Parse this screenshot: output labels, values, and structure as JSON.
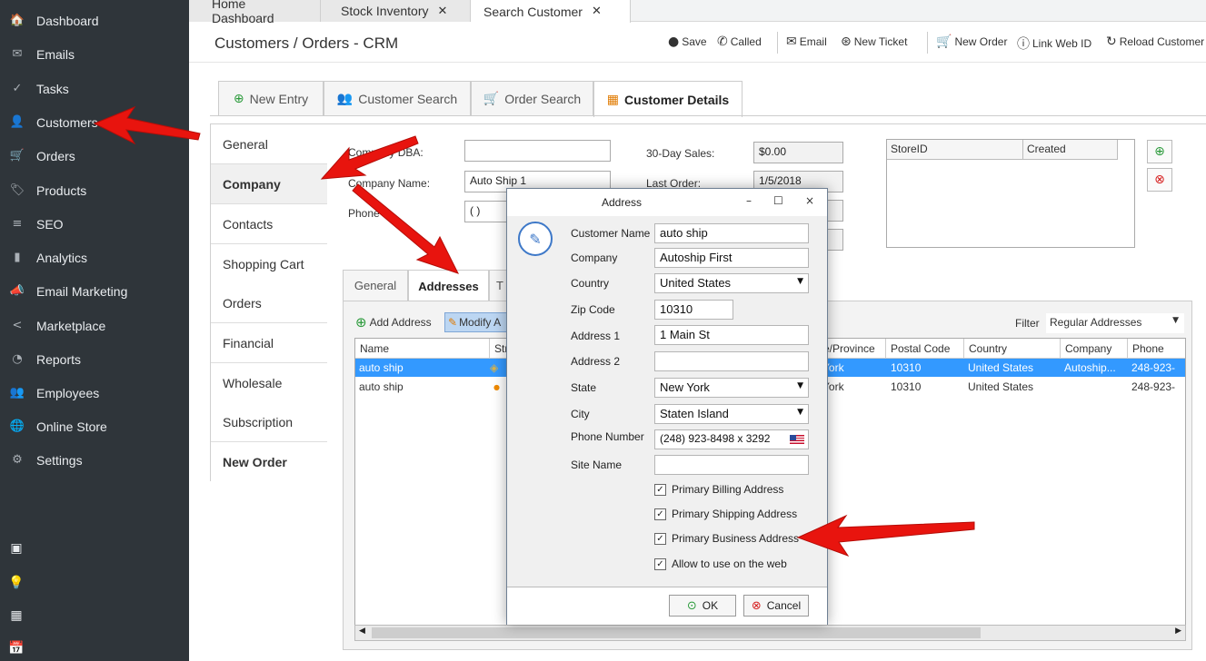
{
  "sidebar": {
    "items": [
      {
        "label": "Dashboard",
        "icon": "🏠"
      },
      {
        "label": "Emails",
        "icon": "✉"
      },
      {
        "label": "Tasks",
        "icon": "✓"
      },
      {
        "label": "Customers",
        "icon": "👤"
      },
      {
        "label": "Orders",
        "icon": "🛒"
      },
      {
        "label": "Products",
        "icon": "🏷"
      },
      {
        "label": "SEO",
        "icon": "≡"
      },
      {
        "label": "Analytics",
        "icon": "▮"
      },
      {
        "label": "Email Marketing",
        "icon": "📣"
      },
      {
        "label": "Marketplace",
        "icon": "<"
      },
      {
        "label": "Reports",
        "icon": "◔"
      },
      {
        "label": "Employees",
        "icon": "👥"
      },
      {
        "label": "Online Store",
        "icon": "🌐"
      },
      {
        "label": "Settings",
        "icon": "⚙"
      }
    ],
    "bottom_icons": [
      "▣",
      "💡",
      "▦",
      "📅"
    ]
  },
  "main_tabs": [
    {
      "label": "Home Dashboard",
      "closable": false
    },
    {
      "label": "Stock Inventory",
      "closable": true
    },
    {
      "label": "Search Customer",
      "closable": true
    }
  ],
  "header": {
    "title": "Customers / Orders - CRM",
    "toolbar": {
      "save": "Save",
      "called": "Called",
      "email": "Email",
      "new_ticket": "New Ticket",
      "new_order": "New Order",
      "link_web_id": "Link Web ID",
      "reload": "Reload Customer"
    }
  },
  "sub_tabs": [
    {
      "label": "New Entry",
      "icon": "⊕"
    },
    {
      "label": "Customer Search",
      "icon": "👥"
    },
    {
      "label": "Order Search",
      "icon": "🛒"
    },
    {
      "label": "Customer Details",
      "icon": "▦"
    }
  ],
  "left_nav": [
    {
      "label": "General",
      "bold": false
    },
    {
      "label": "Company",
      "bold": true
    },
    {
      "label": "Contacts",
      "bold": false
    },
    {
      "label": "Shopping Cart",
      "bold": false
    },
    {
      "label": "Orders",
      "bold": false
    },
    {
      "label": "Financial",
      "bold": false
    },
    {
      "label": "Wholesale",
      "bold": false
    },
    {
      "label": "Subscription",
      "bold": false
    },
    {
      "label": "New Order",
      "bold": true
    }
  ],
  "company_form": {
    "dba_label": "Company DBA:",
    "dba_value": "",
    "name_label": "Company Name:",
    "name_value": "Auto Ship 1",
    "phone_label": "Phone 1:",
    "phone_value": "(   )",
    "sales_label": "30-Day Sales:",
    "sales_value": "$0.00",
    "last_order_label": "Last Order:",
    "last_order_value": "1/5/2018"
  },
  "store_grid": {
    "headers": [
      "StoreID",
      "Created"
    ],
    "add_icon": "⊕",
    "remove_icon": "⊗"
  },
  "inner_tabs": [
    "General",
    "Addresses",
    "T"
  ],
  "address_toolbar": {
    "add": "Add Address",
    "modify": "Modify A",
    "filter_label": "Filter",
    "filter_value": "Regular Addresses"
  },
  "address_grid": {
    "headers": [
      "Name",
      "Str",
      "e/Province",
      "Postal Code",
      "Country",
      "Company",
      "Phone"
    ],
    "rows": [
      {
        "name": "auto ship",
        "marker": "◈",
        "province": "York",
        "postal": "10310",
        "country": "United States",
        "company": "Autoship...",
        "phone": "248-923-"
      },
      {
        "name": "auto ship",
        "marker": "●",
        "province": "York",
        "postal": "10310",
        "country": "United States",
        "company": "",
        "phone": "248-923-"
      }
    ]
  },
  "dialog": {
    "title": "Address",
    "controls": {
      "minimize": "–",
      "maximize": "☐",
      "close": "×"
    },
    "fields": {
      "customer_name_label": "Customer Name",
      "customer_name_value": "auto ship",
      "company_label": "Company",
      "company_value": "Autoship First",
      "country_label": "Country",
      "country_value": "United States",
      "zip_label": "Zip Code",
      "zip_value": "10310",
      "address1_label": "Address 1",
      "address1_value": "1 Main St",
      "address2_label": "Address 2",
      "address2_value": "",
      "state_label": "State",
      "state_value": "New York",
      "city_label": "City",
      "city_value": "Staten Island",
      "phone_label": "Phone Number",
      "phone_value": "(248) 923-8498 x 3292",
      "site_label": "Site Name",
      "site_value": ""
    },
    "checkboxes": [
      {
        "label": "Primary Billing Address",
        "checked": true
      },
      {
        "label": "Primary Shipping Address",
        "checked": true
      },
      {
        "label": "Primary Business Address",
        "checked": true
      },
      {
        "label": "Allow to use on the web",
        "checked": true
      }
    ],
    "ok": "OK",
    "cancel": "Cancel"
  },
  "colors": {
    "sidebar_bg": "#2f353a",
    "selection": "#3399ff",
    "annotation_red": "#e8140e",
    "add_green": "#2a9a3a"
  }
}
